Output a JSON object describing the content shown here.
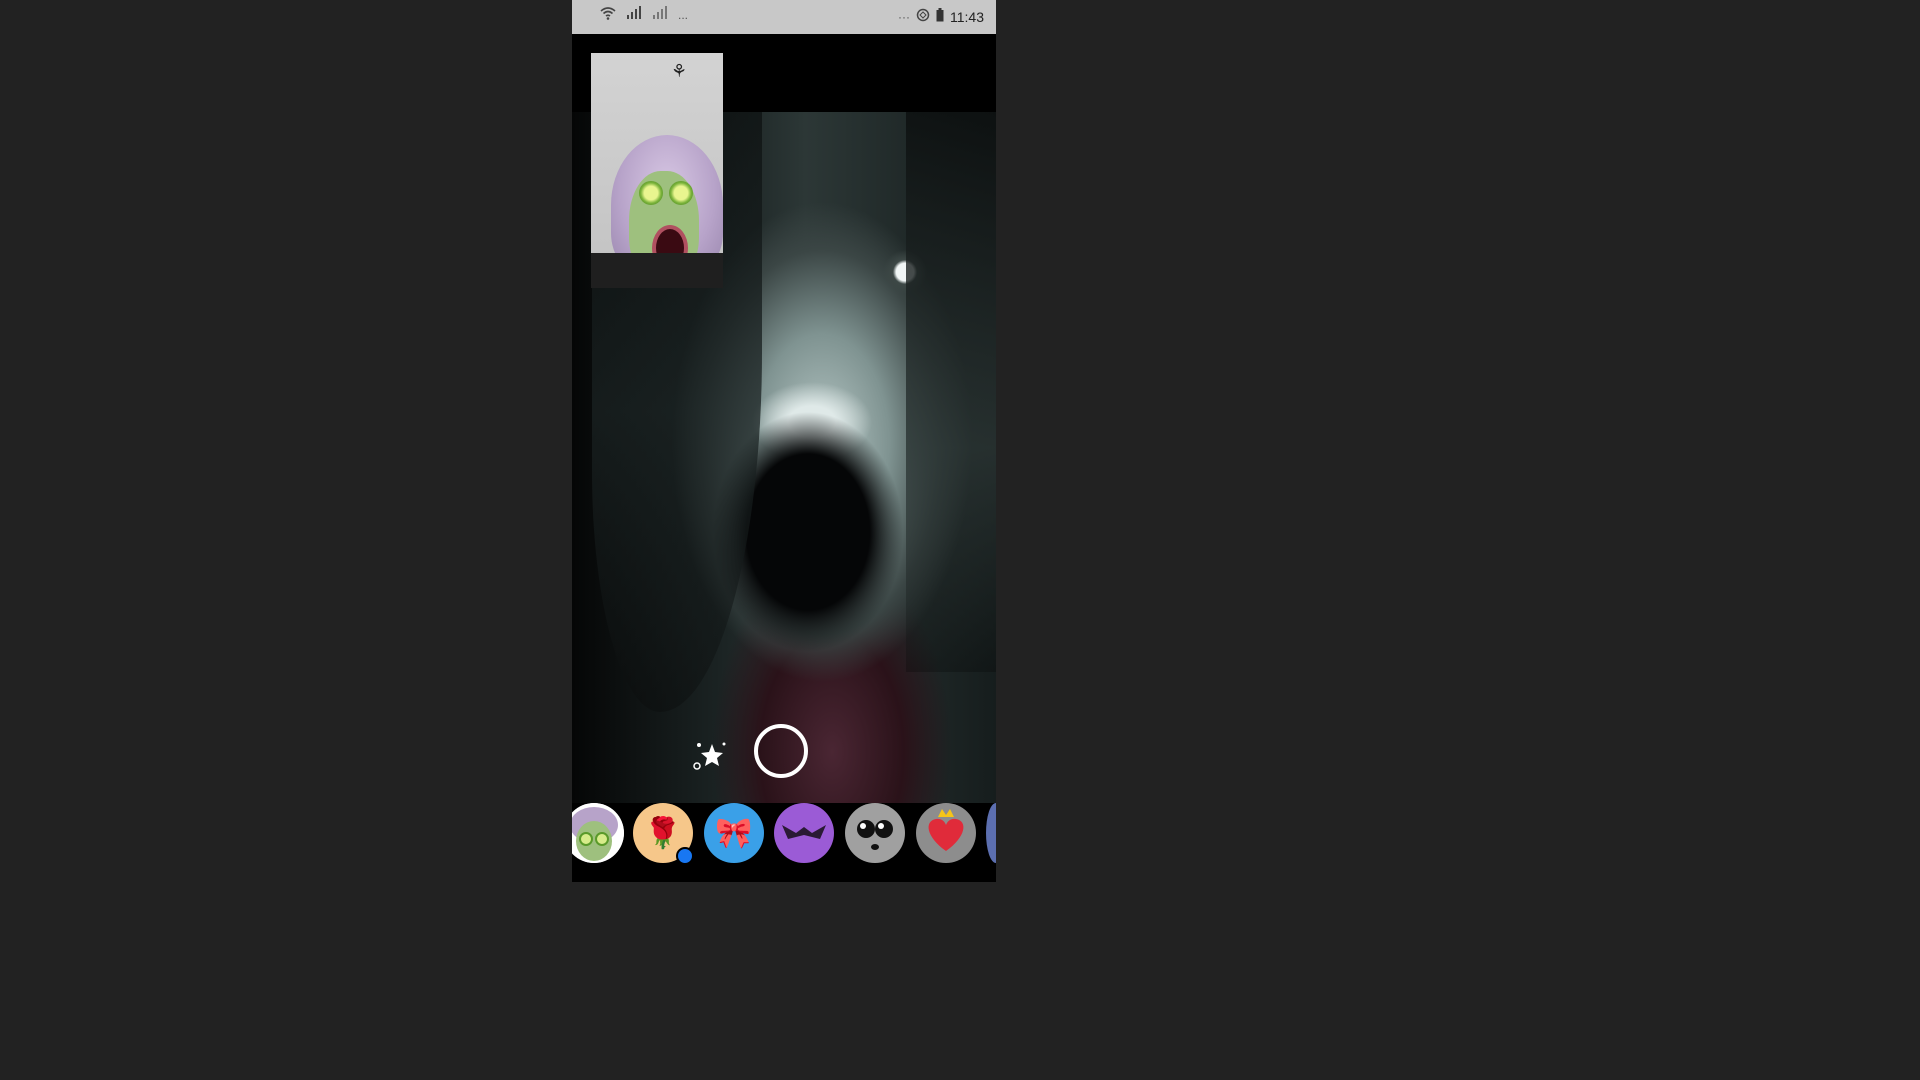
{
  "status_bar": {
    "time": "11:43",
    "left_dots": "...",
    "right_dots": "···",
    "icons": [
      "wifi-icon",
      "signal-icon",
      "signal-icon",
      "sync-icon",
      "battery-icon"
    ]
  },
  "call": {
    "self_view_effect": "cucumber-spa-mask",
    "remote_view": "full-screen-remote-video"
  },
  "controls": {
    "effects_icon": "sparkle-star-icon",
    "capture_icon": "shutter-ring-icon"
  },
  "filters": [
    {
      "name": "spa-mask",
      "glyph": "😴",
      "color": "#ffffff"
    },
    {
      "name": "roses",
      "glyph": "🌹",
      "color": "#f6c78a",
      "badge": true
    },
    {
      "name": "bow",
      "glyph": "🎀",
      "color": "#3aa0e8"
    },
    {
      "name": "bat-wings",
      "glyph": "🦇",
      "color": "#9b5bd6"
    },
    {
      "name": "big-eyes",
      "glyph": "👀",
      "color": "#a0a0a0"
    },
    {
      "name": "heart-crown",
      "glyph": "❤️",
      "color": "#8d8d8d"
    }
  ]
}
